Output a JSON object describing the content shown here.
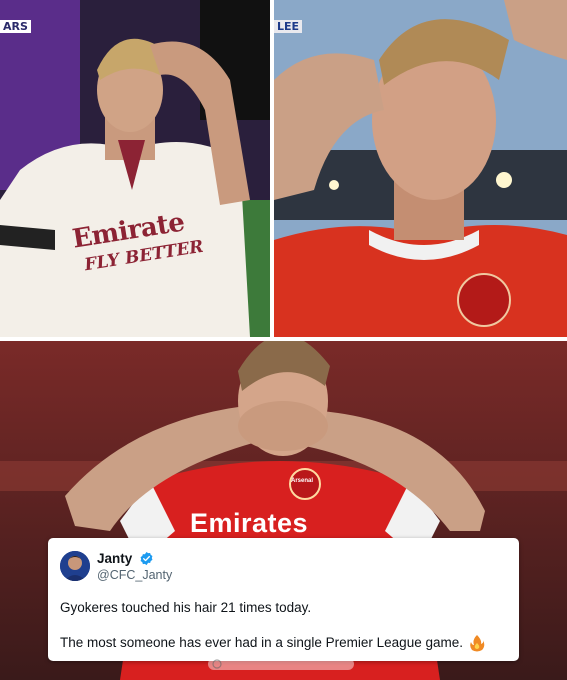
{
  "photos": {
    "top_left": {
      "badge": "ARS",
      "sponsor_line_1": "Emirate",
      "sponsor_line_2": "FLY BETTER"
    },
    "top_right": {
      "badge": "LEE"
    },
    "bottom": {
      "sponsor": "Emirates",
      "crest_label": "Arsenal"
    }
  },
  "tweet": {
    "display_name": "Janty",
    "handle": "@CFC_Janty",
    "verified_icon": "verified-badge-icon",
    "line_1": "Gyokeres touched his hair 21 times today.",
    "line_2": "The most someone has ever had in a single Premier League game.",
    "emoji_icon": "fire-icon"
  },
  "colors": {
    "arsenal_red": "#d8201f",
    "verified_blue": "#1d9bf0",
    "card_bg": "#ffffff"
  }
}
